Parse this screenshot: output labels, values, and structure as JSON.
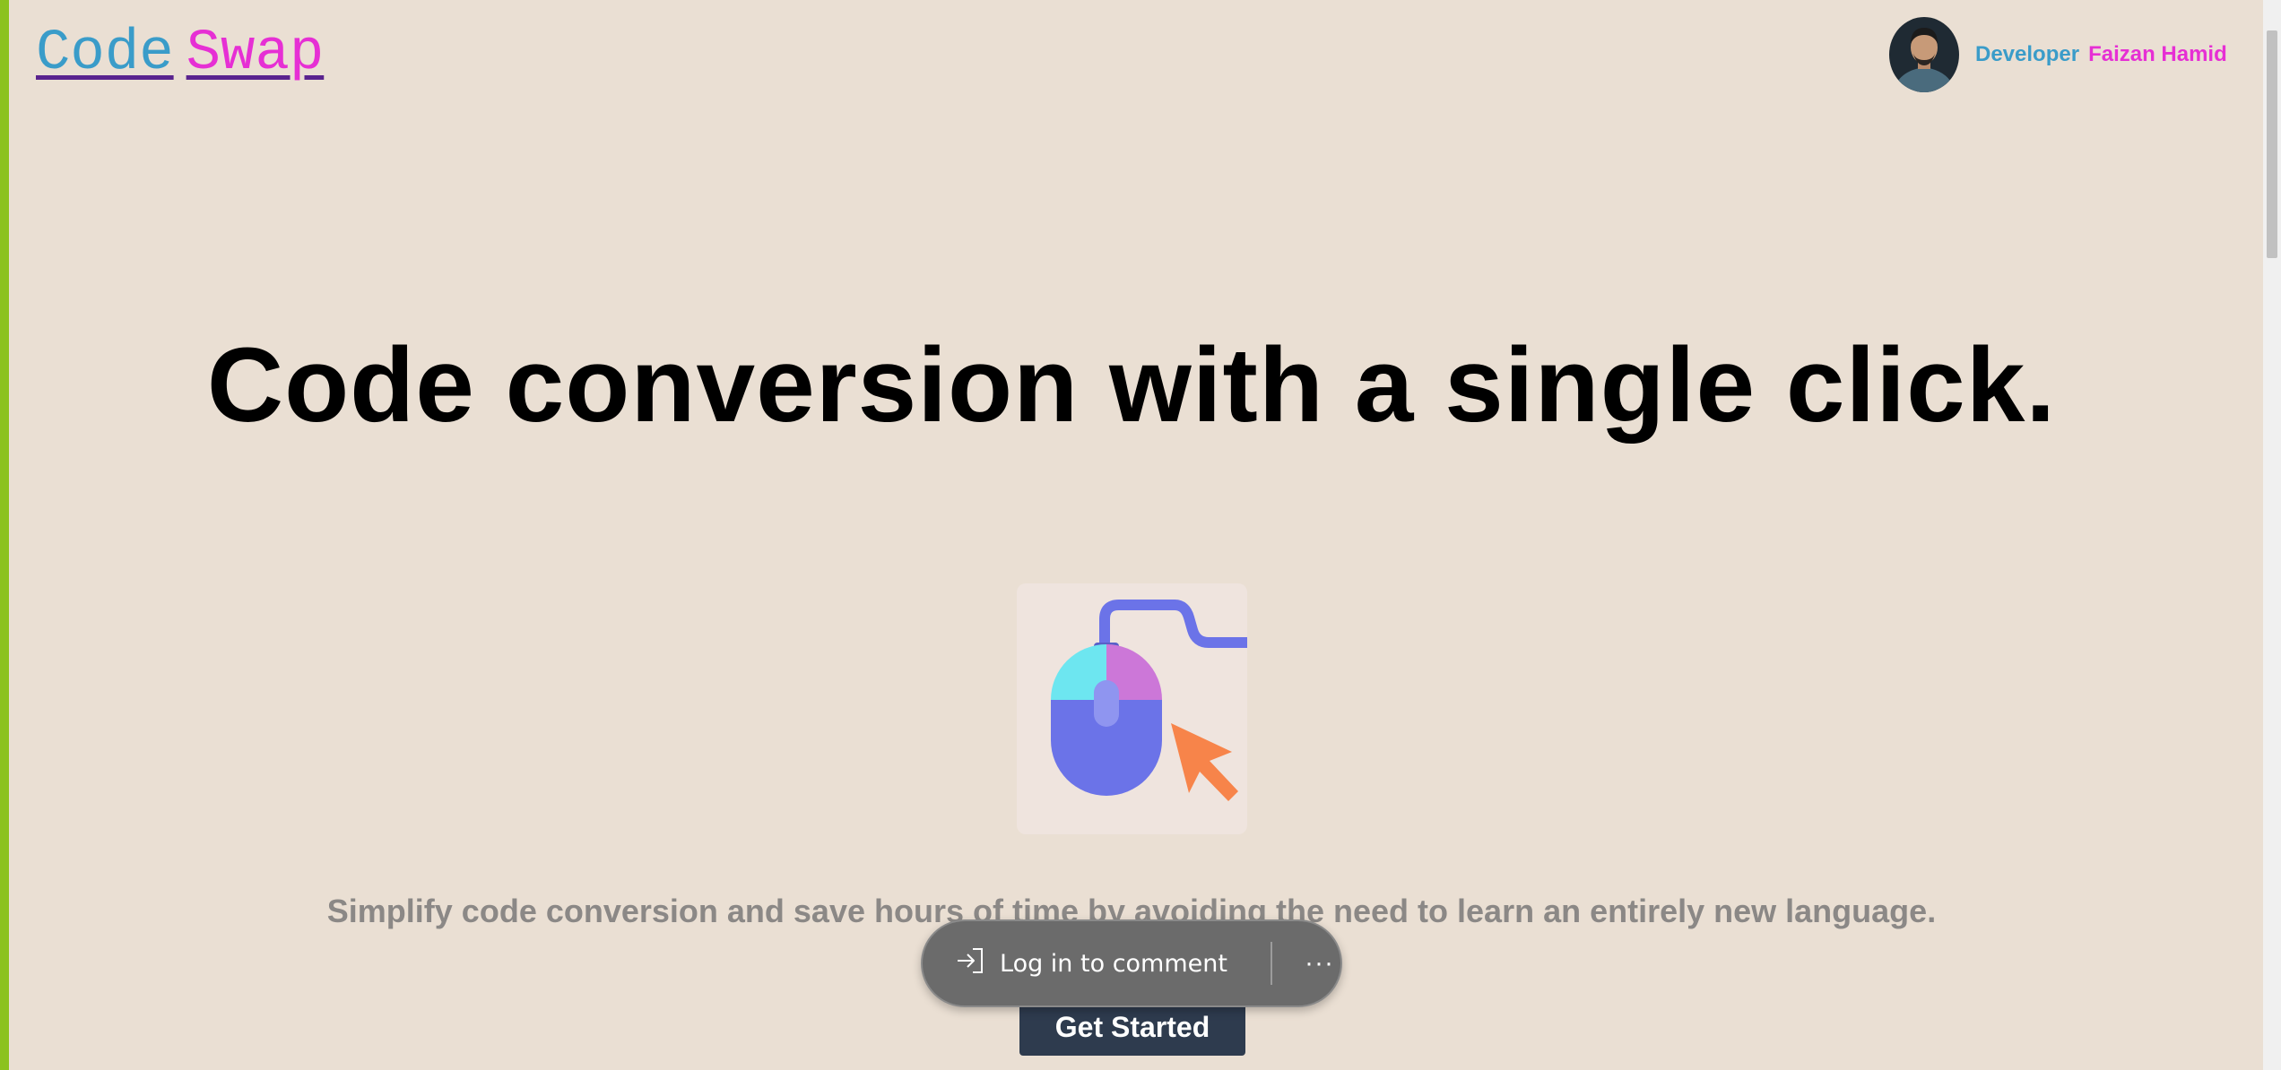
{
  "header": {
    "logo": {
      "part1": "Code",
      "part2": "Swap"
    },
    "developer": {
      "label": "Developer",
      "name": "Faizan Hamid"
    }
  },
  "hero": {
    "headline": "Code conversion with a single click.",
    "subtitle": "Simplify code conversion and save hours of time by avoiding the need to learn an entirely new language.",
    "cta_label": "Get Started"
  },
  "floating_toolbar": {
    "login_label": "Log in to comment",
    "more_label": "···"
  },
  "icons": [
    "login-icon",
    "mouse-icon",
    "cursor-arrow-icon",
    "more-icon"
  ],
  "colors": {
    "background": "#eadfd3",
    "logo_code": "#3a9cc9",
    "logo_swap": "#e62fd4",
    "accent_edge": "#8cc21f",
    "button": "#2e3b4e"
  }
}
